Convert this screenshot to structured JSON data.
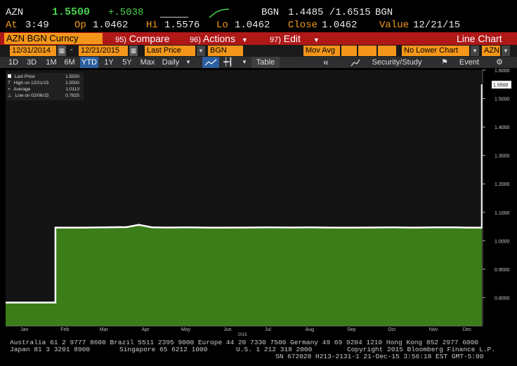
{
  "ticker": {
    "symbol": "AZN",
    "last": "1.5500",
    "change": "+.5038",
    "currency": "BGN",
    "bid_ask": "1.4485 /1.6515",
    "currency2": "BGN",
    "time_label": "At",
    "time": "3:49",
    "open_label": "Op",
    "open": "1.0462",
    "high_label": "Hi",
    "high": "1.5576",
    "low_label": "Lo",
    "low": "1.0462",
    "close_label": "Close",
    "close": "1.0462",
    "value_label": "Value",
    "value": "12/21/15"
  },
  "menu": {
    "currency": "AZN BGN Curncy",
    "compare_num": "95)",
    "compare": "Compare",
    "actions_num": "96)",
    "actions": "Actions",
    "edit_num": "97)",
    "edit": "Edit",
    "chart_type": "Line Chart"
  },
  "fields": {
    "start_date": "12/31/2014",
    "dash": "-",
    "end_date": "12/21/2015",
    "price_field": "Last Price",
    "currency": "BGN",
    "mov_avg": "Mov Avg",
    "lower_chart": "No Lower Chart",
    "security": "AZN"
  },
  "toolbar": {
    "periods": [
      "1D",
      "3D",
      "1M",
      "6M",
      "YTD",
      "1Y",
      "5Y",
      "Max"
    ],
    "active_period": "YTD",
    "frequency": "Daily",
    "table": "Table",
    "back": "«",
    "security_study": "Security/Study",
    "event": "Event"
  },
  "legend": {
    "rows": [
      {
        "label": "Last Price",
        "value": "1.5500"
      },
      {
        "label": "High on 12/21/15",
        "value": "1.5500"
      },
      {
        "label": "Average",
        "value": "1.0113"
      },
      {
        "label": "Low on 02/06/15",
        "value": "0.7825"
      }
    ]
  },
  "last_value_tag": "1.5500",
  "chart_data": {
    "type": "area",
    "x": [
      "2015-01-01",
      "2015-01-15",
      "2015-02-01",
      "2015-02-06",
      "2015-02-07",
      "2015-02-15",
      "2015-03-01",
      "2015-03-15",
      "2015-04-01",
      "2015-04-10",
      "2015-04-20",
      "2015-05-01",
      "2015-05-15",
      "2015-06-01",
      "2015-06-15",
      "2015-07-01",
      "2015-07-15",
      "2015-08-01",
      "2015-08-15",
      "2015-09-01",
      "2015-09-15",
      "2015-10-01",
      "2015-10-15",
      "2015-11-01",
      "2015-11-15",
      "2015-12-01",
      "2015-12-10",
      "2015-12-18",
      "2015-12-21"
    ],
    "y": [
      0.7825,
      0.7825,
      0.7825,
      0.7825,
      1.0462,
      1.0462,
      1.0462,
      1.047,
      1.048,
      1.056,
      1.047,
      1.0465,
      1.047,
      1.0462,
      1.0462,
      1.0465,
      1.047,
      1.0465,
      1.047,
      1.0462,
      1.0462,
      1.0465,
      1.047,
      1.0462,
      1.047,
      1.047,
      1.0462,
      1.0462,
      1.55
    ],
    "xlabel": "2015",
    "x_ticks": [
      "Jan",
      "Feb",
      "Mar",
      "Apr",
      "May",
      "Jun",
      "Jul",
      "Aug",
      "Sep",
      "Oct",
      "Nov",
      "Dec"
    ],
    "y_ticks": [
      "0.8000",
      "0.9000",
      "1.0000",
      "1.1000",
      "1.2000",
      "1.3000",
      "1.4000",
      "1.5000",
      "1.6000"
    ],
    "ylim": [
      0.7,
      1.6
    ],
    "grid": false,
    "fill_color": "#3c7d1a",
    "line_color": "#ffffff"
  },
  "footer": {
    "line1": "Australia 61 2 9777 8600 Brazil 5511 2395 9000 Europe 44 20 7330 7500 Germany 49 69 9204 1210 Hong Kong 852 2977 6000",
    "line2_left": "Japan 81 3 3201 8900",
    "line2_mid": "Singapore 65 6212 1000",
    "line2_us": "U.S. 1 212 318 2000",
    "line2_right": "Copyright 2015 Bloomberg Finance L.P.",
    "line3": "SN 672028 H213-2131-1 21-Dec-15  3:56:18 EST  GMT-5:00"
  }
}
